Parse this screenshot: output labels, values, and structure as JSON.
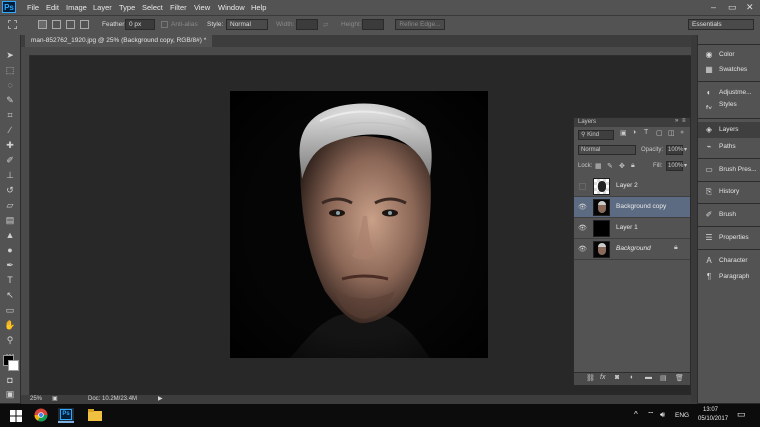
{
  "app": {
    "logo": "Ps"
  },
  "menu": [
    "File",
    "Edit",
    "Image",
    "Layer",
    "Type",
    "Select",
    "Filter",
    "View",
    "Window",
    "Help"
  ],
  "window_controls": [
    "–",
    "▭",
    "✕"
  ],
  "options": {
    "feather_label": "Feather:",
    "feather_value": "0 px",
    "antialias_label": "Anti-alias",
    "style_label": "Style:",
    "style_value": "Normal",
    "width_label": "Width:",
    "height_label": "Height:",
    "refine_label": "Refine Edge...",
    "workspace": "Essentials"
  },
  "document": {
    "tab_title": "man-852762_1920.jpg @ 25% (Background copy, RGB/8#) *",
    "zoom": "25%",
    "doc_info": "Doc: 10.2M/23.4M"
  },
  "layers_panel": {
    "title": "Layers",
    "kind": "Kind",
    "blend_mode": "Normal",
    "opacity_label": "Opacity:",
    "opacity_value": "100%",
    "lock_label": "Lock:",
    "fill_label": "Fill:",
    "fill_value": "100%",
    "layers": [
      {
        "name": "Layer 2",
        "visible": false,
        "selected": false,
        "thumb": "checker-portrait"
      },
      {
        "name": "Background copy",
        "visible": true,
        "selected": true,
        "thumb": "portrait"
      },
      {
        "name": "Layer 1",
        "visible": true,
        "selected": false,
        "thumb": "black"
      },
      {
        "name": "Background",
        "visible": true,
        "selected": false,
        "thumb": "portrait",
        "locked": true
      }
    ]
  },
  "dock": {
    "groups": [
      [
        {
          "label": "Color",
          "icon": "color-icon"
        },
        {
          "label": "Swatches",
          "icon": "swatches-icon"
        }
      ],
      [
        {
          "label": "Adjustme...",
          "icon": "adjustments-icon"
        },
        {
          "label": "Styles",
          "icon": "styles-icon"
        }
      ],
      [
        {
          "label": "Layers",
          "icon": "layers-icon"
        },
        {
          "label": "Paths",
          "icon": "paths-icon"
        }
      ],
      [
        {
          "label": "Brush Pres...",
          "icon": "brush-presets-icon"
        }
      ],
      [
        {
          "label": "History",
          "icon": "history-icon"
        }
      ],
      [
        {
          "label": "Brush",
          "icon": "brush-icon"
        }
      ],
      [
        {
          "label": "Properties",
          "icon": "properties-icon"
        }
      ],
      [
        {
          "label": "Character",
          "icon": "character-icon"
        },
        {
          "label": "Paragraph",
          "icon": "paragraph-icon"
        }
      ]
    ]
  },
  "taskbar": {
    "lang": "ENG",
    "time": "13:07",
    "date": "05/10/2017"
  }
}
